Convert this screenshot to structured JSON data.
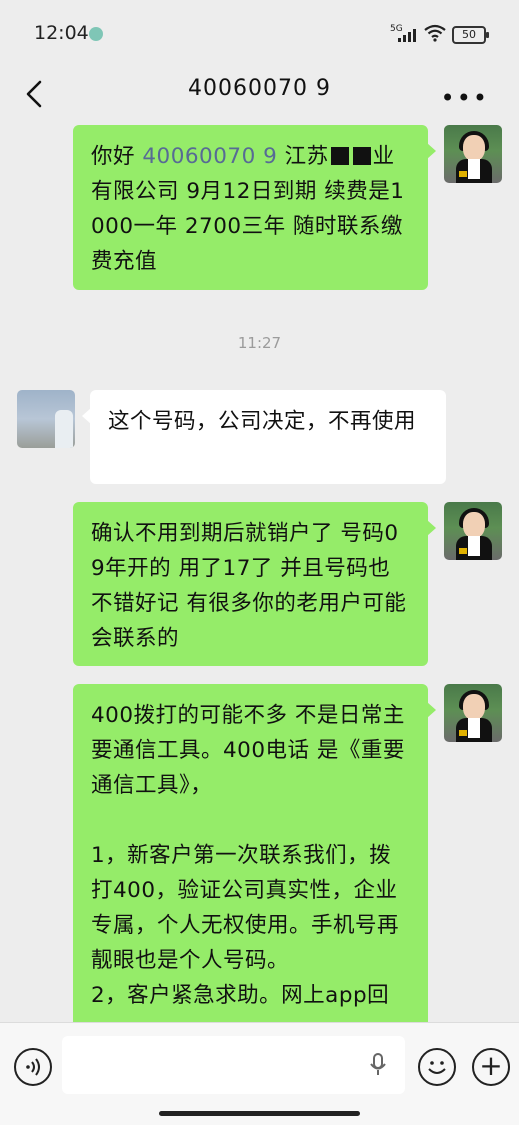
{
  "status_bar": {
    "time": "12:04",
    "network": "5G",
    "battery": "50"
  },
  "header": {
    "title": "40060070 9"
  },
  "chat": {
    "messages": [
      {
        "from": "me",
        "prefix": "你好 ",
        "number": "40060070 9",
        "company_part1": " 江苏",
        "company_part2": "业有限公司  9月12日到期  续费是1000一年  2700三年  随时联系缴费充值"
      },
      {
        "from": "other",
        "text": "这个号码，公司决定，不再使用"
      },
      {
        "from": "me",
        "text": "确认不用到期后就销户了   号码09年开的  用了17了   并且号码也不错好记  有很多你的老用户可能会联系的"
      },
      {
        "from": "me",
        "lines": [
          "400拨打的可能不多 不是日常主要通信工具。400电话  是《重要通信工具》，",
          "",
          "1，新客户第一次联系我们，拨打400，验证公司真实性，企业专属，个人无权使用。手机号再靓眼也是个人号码。",
          "2，客户紧急求助。网上app回"
        ]
      }
    ],
    "timestamp": "11:27"
  },
  "icons": {
    "back": "chevron-left-icon",
    "more": "more-dots-icon",
    "voice": "voice-icon",
    "mic": "microphone-icon",
    "emoji": "emoji-icon",
    "plus": "plus-icon"
  },
  "colors": {
    "my_bubble": "#95ec69",
    "other_bubble": "#ffffff",
    "background": "#ededed",
    "link_number": "#576b95"
  }
}
